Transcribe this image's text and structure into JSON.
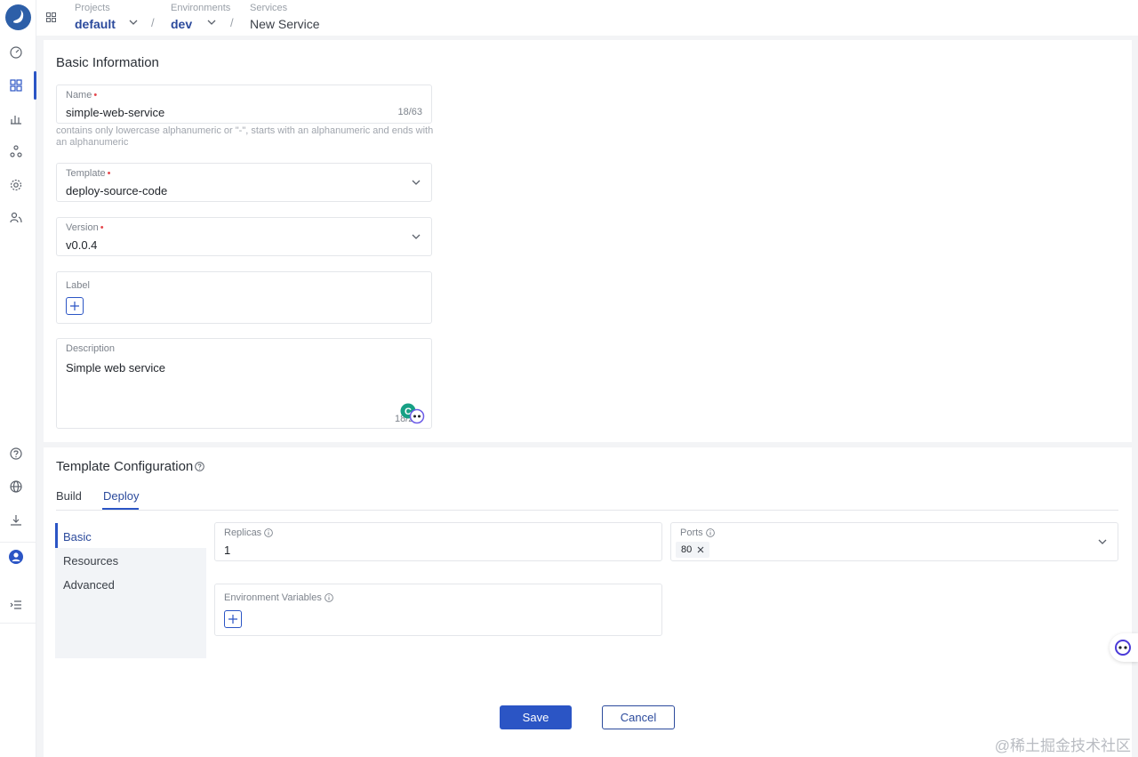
{
  "header": {
    "breadcrumbs": [
      {
        "caption": "Projects",
        "value": "default"
      },
      {
        "caption": "Environments",
        "value": "dev"
      },
      {
        "caption": "Services",
        "value": "New Service"
      }
    ],
    "separator": "/"
  },
  "basic": {
    "title": "Basic Information",
    "name": {
      "label": "Name",
      "value": "simple-web-service",
      "counter": "18/63",
      "hint": "contains only lowercase alphanumeric or \"-\", starts with an alphanumeric and ends with an alphanumeric"
    },
    "template": {
      "label": "Template",
      "value": "deploy-source-code"
    },
    "version": {
      "label": "Version",
      "value": "v0.0.4"
    },
    "label": {
      "label": "Label"
    },
    "description": {
      "label": "Description",
      "value": "Simple web service",
      "counter": "18/2"
    }
  },
  "config": {
    "title": "Template Configuration",
    "tabs": [
      "Build",
      "Deploy"
    ],
    "active_tab": "Deploy",
    "subnav": [
      "Basic",
      "Resources",
      "Advanced"
    ],
    "active_subnav": "Basic",
    "replicas": {
      "label": "Replicas",
      "value": "1"
    },
    "ports": {
      "label": "Ports",
      "tags": [
        "80"
      ]
    },
    "env_vars": {
      "label": "Environment Variables"
    }
  },
  "actions": {
    "save": "Save",
    "cancel": "Cancel"
  },
  "watermark": "@稀土掘金技术社区",
  "colors": {
    "accent": "#2b55c5",
    "brand_dark": "#2b4a9c",
    "required": "#e5484d"
  }
}
